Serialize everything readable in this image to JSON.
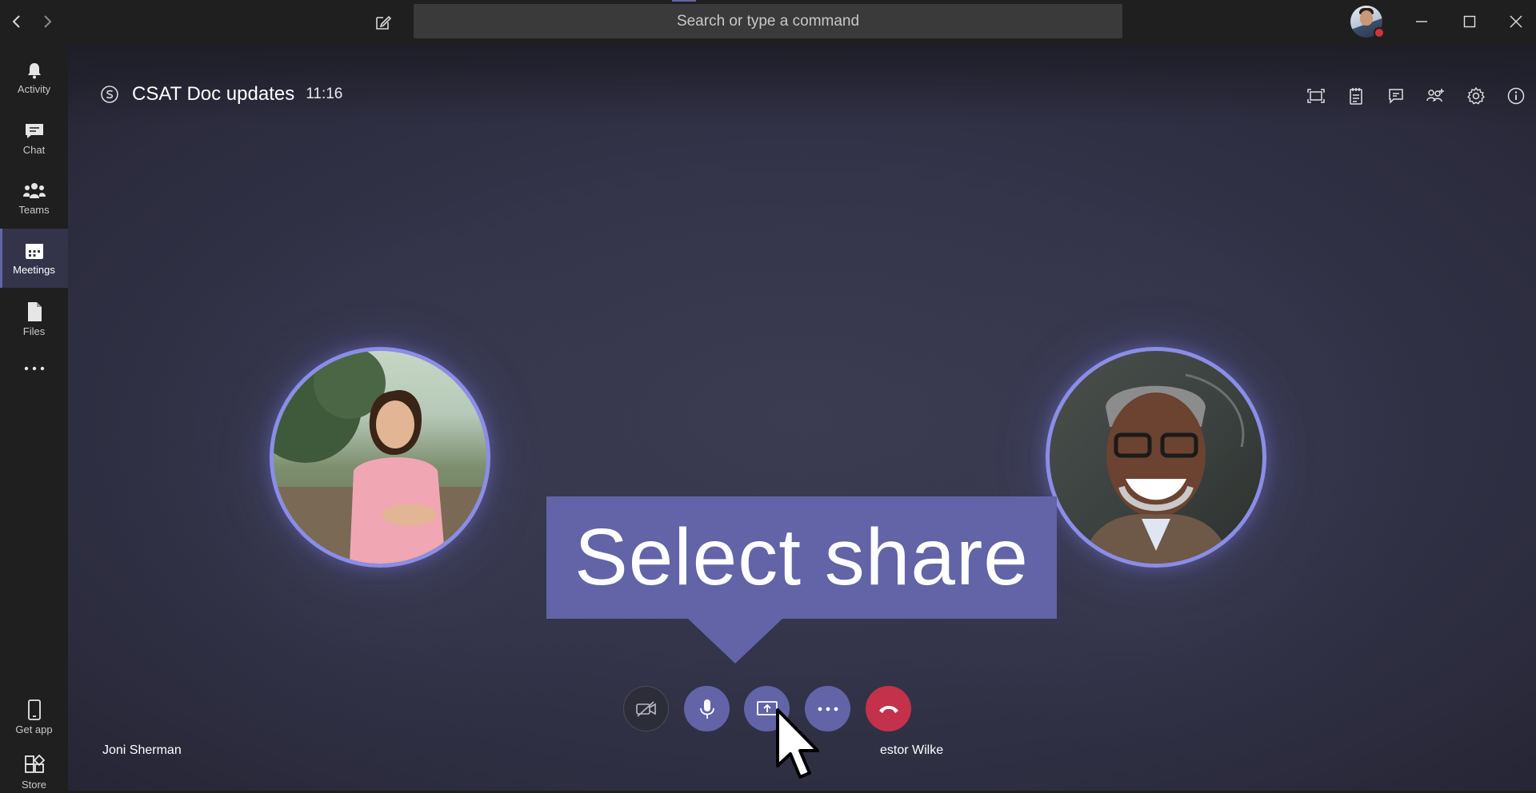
{
  "titlebar": {
    "search_placeholder": "Search or type a command",
    "back_icon": "chevron-left-icon",
    "forward_icon": "chevron-right-icon",
    "compose_icon": "compose-icon",
    "presence_status_color": "#d13438"
  },
  "rail": {
    "items": [
      {
        "label": "Activity",
        "icon": "bell-icon"
      },
      {
        "label": "Chat",
        "icon": "chat-icon"
      },
      {
        "label": "Teams",
        "icon": "teams-icon"
      },
      {
        "label": "Meetings",
        "icon": "calendar-icon",
        "active": true
      },
      {
        "label": "Files",
        "icon": "file-icon"
      },
      {
        "label": "",
        "icon": "more-icon"
      }
    ],
    "bottom": [
      {
        "label": "Get app",
        "icon": "phone-icon"
      },
      {
        "label": "Store",
        "icon": "store-icon"
      }
    ]
  },
  "meeting": {
    "title": "CSAT Doc updates",
    "elapsed": "11:16",
    "participants": [
      {
        "name": "Joni Sherman"
      },
      {
        "name": "estor Wilke"
      }
    ]
  },
  "callout": {
    "text": "Select share"
  },
  "controls": {
    "video": "video-off-icon",
    "mic": "mic-icon",
    "share": "share-screen-icon",
    "more": "more-icon",
    "hangup": "hang-up-icon"
  },
  "colors": {
    "accent": "#6264a7",
    "hangup": "#c4314b",
    "ring": "#8b8de6"
  }
}
